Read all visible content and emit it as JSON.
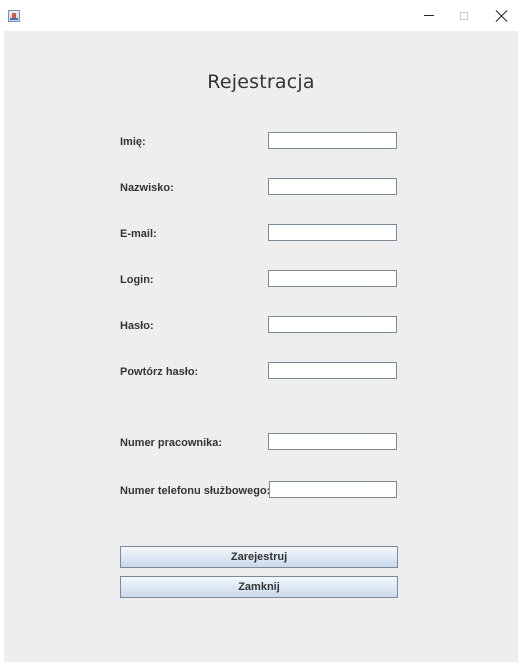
{
  "window": {
    "icon": "java-cup-icon",
    "controls": {
      "minimize": "minimize-icon",
      "maximize": "maximize-icon",
      "close": "close-icon"
    }
  },
  "form": {
    "title": "Rejestracja",
    "fields": {
      "first_name": {
        "label": "Imię:",
        "value": ""
      },
      "last_name": {
        "label": "Nazwisko:",
        "value": ""
      },
      "email": {
        "label": "E-mail:",
        "value": ""
      },
      "login": {
        "label": "Login:",
        "value": ""
      },
      "password": {
        "label": "Hasło:",
        "value": ""
      },
      "password_repeat": {
        "label": "Powtórz hasło:",
        "value": ""
      },
      "employee_number": {
        "label": "Numer pracownika:",
        "value": ""
      },
      "work_phone": {
        "label": "Numer telefonu służbowego:",
        "value": ""
      }
    },
    "buttons": {
      "register": "Zarejestruj",
      "close": "Zamknij"
    }
  },
  "colors": {
    "panel_background": "#eeeeee",
    "field_border": "#7a8a99",
    "text": "#333333"
  }
}
